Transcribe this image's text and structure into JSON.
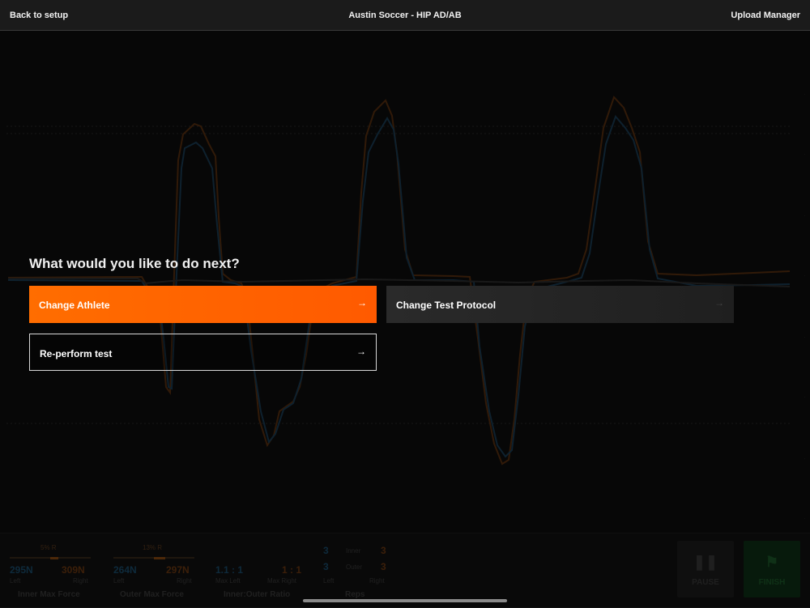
{
  "topbar": {
    "back_label": "Back to setup",
    "title": "Austin Soccer - HIP AD/AB",
    "upload_label": "Upload Manager"
  },
  "colors": {
    "accent": "#ff6a00",
    "left_series": "#1a4e6d",
    "right_series": "#6e3a12",
    "finish_bg": "#0e3116"
  },
  "dialog": {
    "prompt": "What would you like to do next?",
    "options": [
      {
        "label": "Change Athlete",
        "icon": "arrow-right-icon"
      },
      {
        "label": "Change Test Protocol",
        "icon": "arrow-right-icon"
      },
      {
        "label": "Re-perform test",
        "icon": "arrow-right-icon"
      }
    ]
  },
  "stats": {
    "inner_max": {
      "pct": "5% R",
      "pct_fraction": 0.05,
      "left": "295N",
      "right": "309N",
      "left_label": "Left",
      "right_label": "Right",
      "title": "Inner Max Force"
    },
    "outer_max": {
      "pct": "13% R",
      "pct_fraction": 0.13,
      "left": "264N",
      "right": "297N",
      "left_label": "Left",
      "right_label": "Right",
      "title": "Outer Max Force"
    },
    "ratio": {
      "left": "1.1 : 1",
      "right": "1 : 1",
      "left_label": "Max Left",
      "right_label": "Max Right",
      "title": "Inner:Outer Ratio"
    },
    "reps": {
      "inner_left": "3",
      "inner_label": "Inner",
      "inner_right": "3",
      "outer_left": "3",
      "outer_label": "Outer",
      "outer_right": "3",
      "left_label": "Left",
      "right_label": "Right",
      "title": "Reps"
    }
  },
  "controls": {
    "pause_label": "PAUSE",
    "pause_icon": "pause-icon",
    "finish_label": "FINISH",
    "finish_icon": "checkered-flag-icon"
  }
}
